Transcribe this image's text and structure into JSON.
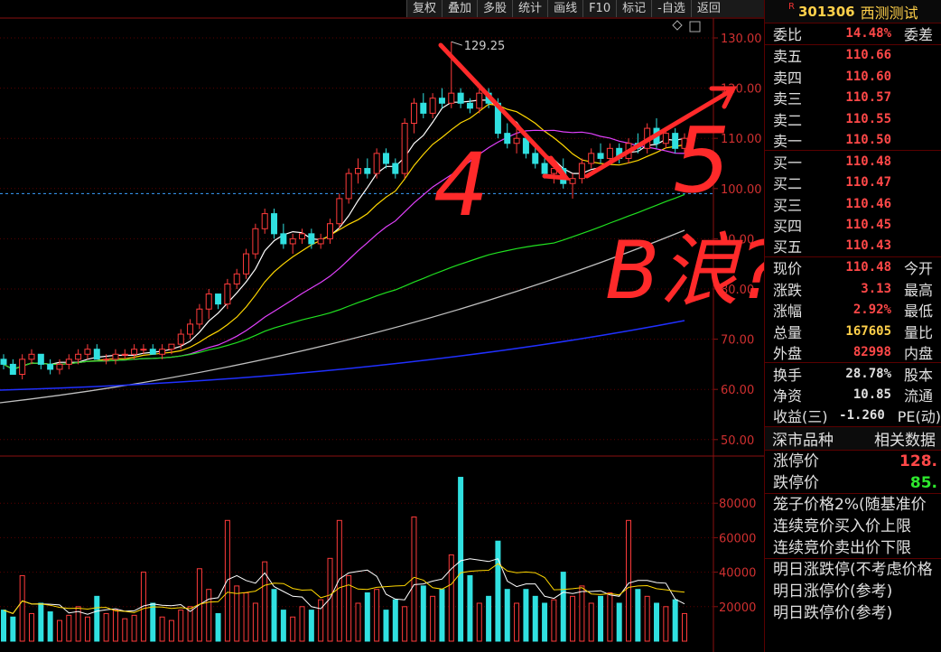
{
  "toolbar": {
    "items": [
      "复权",
      "叠加",
      "多股",
      "统计",
      "画线",
      "F10",
      "标记",
      "-自选",
      "返回"
    ]
  },
  "stock": {
    "badge": "R",
    "code": "301306",
    "name": "西测测试"
  },
  "quote": {
    "weibi": {
      "label": "委比",
      "value": "14.48%",
      "right": "委差"
    },
    "sells": [
      {
        "label": "卖五",
        "price": "110.66"
      },
      {
        "label": "卖四",
        "price": "110.60"
      },
      {
        "label": "卖三",
        "price": "110.57"
      },
      {
        "label": "卖二",
        "price": "110.55"
      },
      {
        "label": "卖一",
        "price": "110.50"
      }
    ],
    "buys": [
      {
        "label": "买一",
        "price": "110.48"
      },
      {
        "label": "买二",
        "price": "110.47"
      },
      {
        "label": "买三",
        "price": "110.46"
      },
      {
        "label": "买四",
        "price": "110.45"
      },
      {
        "label": "买五",
        "price": "110.43"
      }
    ],
    "stats": [
      {
        "label": "现价",
        "value": "110.48",
        "right": "今开",
        "color": "red"
      },
      {
        "label": "涨跌",
        "value": "3.13",
        "right": "最高",
        "color": "red"
      },
      {
        "label": "涨幅",
        "value": "2.92%",
        "right": "最低",
        "color": "red"
      },
      {
        "label": "总量",
        "value": "167605",
        "right": "量比",
        "color": "yel"
      },
      {
        "label": "外盘",
        "value": "82998",
        "right": "内盘",
        "color": "red"
      }
    ],
    "fin": [
      {
        "label": "换手",
        "value": "28.78%",
        "right": "股本",
        "color": "wht"
      },
      {
        "label": "净资",
        "value": "10.85",
        "right": "流通",
        "color": "wht"
      },
      {
        "label": "收益(三)",
        "value": "-1.260",
        "right": "PE(动)",
        "color": "wht"
      }
    ]
  },
  "section": {
    "left": "深市品种",
    "right": "相关数据"
  },
  "limits": {
    "up_label": "涨停价",
    "up_value": "128.",
    "down_label": "跌停价",
    "down_value": "85."
  },
  "cage": {
    "l1": "笼子价格2%(随基准价",
    "l2": "连续竞价买入价上限",
    "l3": "连续竞价卖出价下限"
  },
  "tomorrow": {
    "l1": "明日涨跌停(不考虑价格",
    "l2": "明日涨停价(参考)",
    "l3": "明日跌停价(参考)"
  },
  "chart_data": {
    "type": "candlestick",
    "price_ticks": [
      "130.00",
      "120.00",
      "110.00",
      "100.00",
      "90.00",
      "80.00",
      "70.00",
      "60.00",
      "50.00"
    ],
    "volume_ticks": [
      "80000",
      "60000",
      "40000",
      "20000"
    ],
    "peak_label": "129.25",
    "current_price": 99.0,
    "candles": [
      [
        66,
        67,
        64,
        65
      ],
      [
        65,
        66,
        63,
        63
      ],
      [
        63,
        67,
        62,
        66
      ],
      [
        66,
        68,
        65,
        67
      ],
      [
        67,
        67,
        64,
        65
      ],
      [
        65,
        66,
        63,
        64
      ],
      [
        64,
        66,
        63,
        65
      ],
      [
        65,
        67,
        64,
        66
      ],
      [
        66,
        68,
        65,
        67
      ],
      [
        67,
        69,
        66,
        68
      ],
      [
        68,
        69,
        66,
        66
      ],
      [
        66,
        67,
        65,
        66
      ],
      [
        66,
        68,
        65,
        67
      ],
      [
        67,
        68,
        66,
        67
      ],
      [
        67,
        69,
        66,
        68
      ],
      [
        68,
        69,
        67,
        68
      ],
      [
        68,
        69,
        67,
        67
      ],
      [
        67,
        69,
        66,
        68
      ],
      [
        68,
        69,
        67,
        69
      ],
      [
        69,
        72,
        68,
        71
      ],
      [
        71,
        74,
        70,
        73
      ],
      [
        73,
        77,
        72,
        76
      ],
      [
        76,
        80,
        74,
        79
      ],
      [
        79,
        79,
        76,
        77
      ],
      [
        77,
        82,
        76,
        81
      ],
      [
        81,
        84,
        80,
        83
      ],
      [
        83,
        88,
        82,
        87
      ],
      [
        87,
        93,
        86,
        92
      ],
      [
        92,
        96,
        91,
        95
      ],
      [
        95,
        96,
        90,
        91
      ],
      [
        91,
        93,
        88,
        89
      ],
      [
        89,
        91,
        87,
        90
      ],
      [
        90,
        92,
        89,
        91
      ],
      [
        91,
        92,
        88,
        89
      ],
      [
        89,
        91,
        88,
        90
      ],
      [
        90,
        94,
        89,
        93
      ],
      [
        93,
        99,
        92,
        98
      ],
      [
        98,
        104,
        97,
        103
      ],
      [
        103,
        106,
        101,
        104
      ],
      [
        104,
        106,
        102,
        103
      ],
      [
        103,
        108,
        102,
        107
      ],
      [
        107,
        108,
        104,
        105
      ],
      [
        105,
        106,
        102,
        103
      ],
      [
        103,
        114,
        102,
        113
      ],
      [
        113,
        118,
        111,
        117
      ],
      [
        117,
        119,
        114,
        115
      ],
      [
        115,
        119,
        114,
        118
      ],
      [
        118,
        120,
        116,
        117
      ],
      [
        117,
        129.25,
        116,
        119
      ],
      [
        119,
        120,
        116,
        117
      ],
      [
        117,
        118,
        115,
        116
      ],
      [
        116,
        120,
        115,
        119
      ],
      [
        119,
        120,
        116,
        117
      ],
      [
        117,
        118,
        110,
        111
      ],
      [
        111,
        113,
        108,
        109
      ],
      [
        109,
        112,
        107,
        110
      ],
      [
        110,
        111,
        106,
        107
      ],
      [
        107,
        109,
        104,
        105
      ],
      [
        105,
        106,
        102,
        103
      ],
      [
        103,
        105,
        101,
        104
      ],
      [
        104,
        106,
        100,
        101
      ],
      [
        101,
        103,
        98,
        102
      ],
      [
        102,
        106,
        101,
        105
      ],
      [
        105,
        108,
        104,
        107
      ],
      [
        107,
        109,
        105,
        106
      ],
      [
        106,
        109,
        105,
        108
      ],
      [
        108,
        109,
        105,
        106
      ],
      [
        106,
        110,
        105,
        109
      ],
      [
        109,
        111,
        107,
        108
      ],
      [
        108,
        113,
        107,
        112
      ],
      [
        112,
        114,
        108,
        109
      ],
      [
        109,
        112,
        108,
        111
      ],
      [
        111,
        112,
        107,
        108
      ],
      [
        108,
        111,
        107,
        110
      ]
    ],
    "volumes": [
      18000,
      14000,
      38000,
      16000,
      22000,
      17000,
      12000,
      15000,
      20000,
      14000,
      26000,
      16000,
      18000,
      13000,
      15000,
      40000,
      22000,
      14000,
      12000,
      18000,
      20000,
      42000,
      30000,
      16000,
      70000,
      32000,
      28000,
      22000,
      46000,
      30000,
      18000,
      14000,
      20000,
      18000,
      24000,
      48000,
      70000,
      38000,
      22000,
      28000,
      30000,
      18000,
      24000,
      20000,
      72000,
      32000,
      26000,
      30000,
      50000,
      95000,
      38000,
      22000,
      26000,
      58000,
      30000,
      22000,
      30000,
      26000,
      22000,
      24000,
      40000,
      26000,
      32000,
      22000,
      26000,
      28000,
      22000,
      70000,
      30000,
      26000,
      22000,
      20000,
      24000,
      16000
    ],
    "ma_colors": [
      "#ffffff",
      "#ffd700",
      "#e040fb",
      "#20e020",
      "#c0c0c0",
      "#2030ff"
    ],
    "annotations": [
      "4",
      "5",
      "B浪?"
    ]
  }
}
